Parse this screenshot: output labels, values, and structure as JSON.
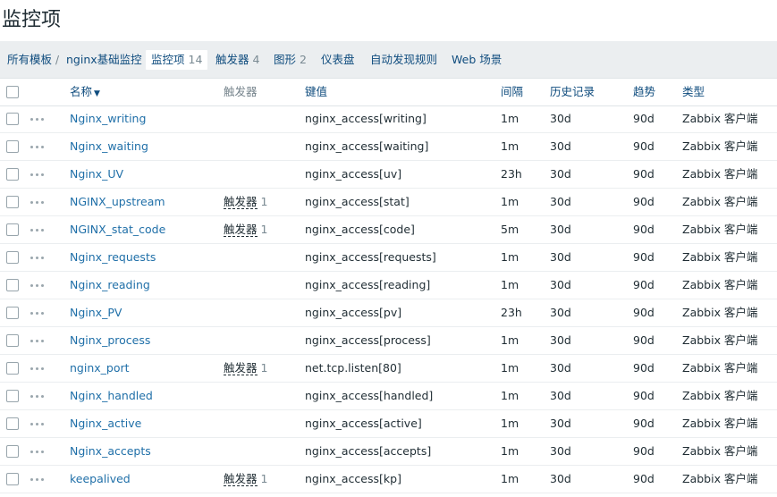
{
  "page": {
    "title": "监控项"
  },
  "tabs": {
    "all_templates": "所有模板",
    "separator": "/",
    "template_name": "nginx基础监控",
    "items": {
      "label": "监控项",
      "count": "14"
    },
    "triggers": {
      "label": "触发器",
      "count": "4"
    },
    "graphs": {
      "label": "图形",
      "count": "2"
    },
    "dashboards": "仪表盘",
    "discovery": "自动发现规则",
    "web": "Web 场景"
  },
  "table": {
    "columns": {
      "name": "名称",
      "triggers": "触发器",
      "key": "键值",
      "interval": "间隔",
      "history": "历史记录",
      "trends": "趋势",
      "type": "类型"
    },
    "sort_indicator": "▼",
    "rows": [
      {
        "name": "Nginx_writing",
        "trigger_label": "",
        "trigger_count": "",
        "key": "nginx_access[writing]",
        "interval": "1m",
        "history": "30d",
        "trends": "90d",
        "type": "Zabbix 客户端"
      },
      {
        "name": "Nginx_waiting",
        "trigger_label": "",
        "trigger_count": "",
        "key": "nginx_access[waiting]",
        "interval": "1m",
        "history": "30d",
        "trends": "90d",
        "type": "Zabbix 客户端"
      },
      {
        "name": "Nginx_UV",
        "trigger_label": "",
        "trigger_count": "",
        "key": "nginx_access[uv]",
        "interval": "23h",
        "history": "30d",
        "trends": "90d",
        "type": "Zabbix 客户端"
      },
      {
        "name": "NGINX_upstream",
        "trigger_label": "触发器",
        "trigger_count": "1",
        "key": "nginx_access[stat]",
        "interval": "1m",
        "history": "30d",
        "trends": "90d",
        "type": "Zabbix 客户端"
      },
      {
        "name": "NGINX_stat_code",
        "trigger_label": "触发器",
        "trigger_count": "1",
        "key": "nginx_access[code]",
        "interval": "5m",
        "history": "30d",
        "trends": "90d",
        "type": "Zabbix 客户端"
      },
      {
        "name": "Nginx_requests",
        "trigger_label": "",
        "trigger_count": "",
        "key": "nginx_access[requests]",
        "interval": "1m",
        "history": "30d",
        "trends": "90d",
        "type": "Zabbix 客户端"
      },
      {
        "name": "Nginx_reading",
        "trigger_label": "",
        "trigger_count": "",
        "key": "nginx_access[reading]",
        "interval": "1m",
        "history": "30d",
        "trends": "90d",
        "type": "Zabbix 客户端"
      },
      {
        "name": "Nginx_PV",
        "trigger_label": "",
        "trigger_count": "",
        "key": "nginx_access[pv]",
        "interval": "23h",
        "history": "30d",
        "trends": "90d",
        "type": "Zabbix 客户端"
      },
      {
        "name": "Nginx_process",
        "trigger_label": "",
        "trigger_count": "",
        "key": "nginx_access[process]",
        "interval": "1m",
        "history": "30d",
        "trends": "90d",
        "type": "Zabbix 客户端"
      },
      {
        "name": "nginx_port",
        "trigger_label": "触发器",
        "trigger_count": "1",
        "key": "net.tcp.listen[80]",
        "interval": "1m",
        "history": "30d",
        "trends": "90d",
        "type": "Zabbix 客户端"
      },
      {
        "name": "Nginx_handled",
        "trigger_label": "",
        "trigger_count": "",
        "key": "nginx_access[handled]",
        "interval": "1m",
        "history": "30d",
        "trends": "90d",
        "type": "Zabbix 客户端"
      },
      {
        "name": "Nginx_active",
        "trigger_label": "",
        "trigger_count": "",
        "key": "nginx_access[active]",
        "interval": "1m",
        "history": "30d",
        "trends": "90d",
        "type": "Zabbix 客户端"
      },
      {
        "name": "Nginx_accepts",
        "trigger_label": "",
        "trigger_count": "",
        "key": "nginx_access[accepts]",
        "interval": "1m",
        "history": "30d",
        "trends": "90d",
        "type": "Zabbix 客户端"
      },
      {
        "name": "keepalived",
        "trigger_label": "触发器",
        "trigger_count": "1",
        "key": "nginx_access[kp]",
        "interval": "1m",
        "history": "30d",
        "trends": "90d",
        "type": "Zabbix 客户端"
      }
    ]
  }
}
